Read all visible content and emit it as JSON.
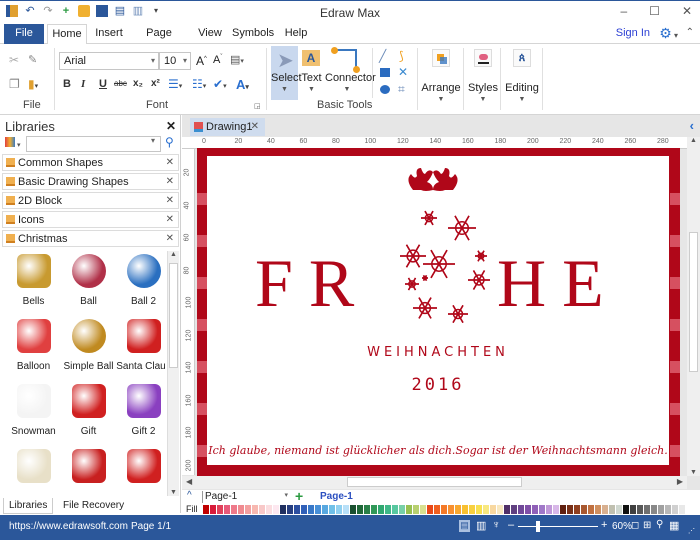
{
  "app": {
    "title": "Edraw Max",
    "window_controls": [
      "minimize",
      "maximize",
      "close"
    ]
  },
  "quick_access": [
    "app-logo-icon",
    "undo-icon",
    "redo-icon",
    "new-icon",
    "open-icon",
    "save-icon",
    "print-icon",
    "export-icon",
    "customize-icon"
  ],
  "menu": {
    "file": "File",
    "tabs": [
      "Home",
      "Insert",
      "Page Layout",
      "View",
      "Symbols",
      "Help"
    ],
    "active_tab": "Home",
    "sign_in": "Sign In"
  },
  "ribbon": {
    "groups": {
      "file": "File",
      "font": "Font",
      "basic_tools": "Basic Tools"
    },
    "font_name": "Arial",
    "font_size": "10",
    "format_buttons": [
      "B",
      "I",
      "U",
      "abc",
      "x₂",
      "x²"
    ],
    "tools": {
      "select": "Select",
      "text": "Text",
      "connector": "Connector"
    },
    "arrange": "Arrange",
    "styles": "Styles",
    "editing": "Editing"
  },
  "libraries": {
    "title": "Libraries",
    "search_placeholder": "",
    "items": [
      {
        "label": "Common Shapes"
      },
      {
        "label": "Basic Drawing Shapes"
      },
      {
        "label": "2D Block"
      },
      {
        "label": "Icons"
      },
      {
        "label": "Christmas"
      }
    ],
    "shapes": [
      {
        "name": "Bells",
        "color": "#c89a30"
      },
      {
        "name": "Ball",
        "color": "#b03048"
      },
      {
        "name": "Ball 2",
        "color": "#2a6fc0"
      },
      {
        "name": "Balloon",
        "color": "#e04040"
      },
      {
        "name": "Simple Ball",
        "color": "#c08a20"
      },
      {
        "name": "Santa Claus",
        "color": "#d02020"
      },
      {
        "name": "Snowman",
        "color": "#f4f4f4"
      },
      {
        "name": "Gift",
        "color": "#d02020"
      },
      {
        "name": "Gift 2",
        "color": "#8a40c0"
      },
      {
        "name": "",
        "color": "#e8e0c8"
      },
      {
        "name": "",
        "color": "#c82020"
      },
      {
        "name": "",
        "color": "#d02020"
      }
    ],
    "bottom_tabs": [
      "Libraries",
      "File Recovery"
    ]
  },
  "document": {
    "tab": "Drawing1",
    "ruler_h": [
      "0",
      "20",
      "40",
      "60",
      "80",
      "100",
      "120",
      "140",
      "160",
      "180",
      "200",
      "220",
      "240",
      "260",
      "280"
    ],
    "ruler_v": [
      "20",
      "40",
      "60",
      "80",
      "100",
      "120",
      "140",
      "160",
      "180",
      "200"
    ],
    "card": {
      "left_word": "FR",
      "right_word": "HE",
      "subtitle": "WEIHNACHTEN",
      "year": "2016",
      "quote": "Ich glaube, niemand ist glücklicher als dich.Sogar ist der Weihnachtsmann gleich.",
      "accent": "#b00719"
    }
  },
  "pages": {
    "selector": "Page-1",
    "current": "Page-1",
    "fill_label": "Fill"
  },
  "palette": [
    "#c00000",
    "#d81b3a",
    "#e0405a",
    "#e85a7a",
    "#ee7a8a",
    "#f08a90",
    "#f4a0a0",
    "#f7b8b0",
    "#f8c8c8",
    "#fbdde0",
    "#fde8f0",
    "#203060",
    "#283f80",
    "#2d4fa0",
    "#3060b8",
    "#3878c8",
    "#4890d8",
    "#58a8e0",
    "#70c0e8",
    "#90d0f0",
    "#b8e0f8",
    "#1a5030",
    "#206838",
    "#2a8048",
    "#309858",
    "#30a870",
    "#40b888",
    "#58c8a0",
    "#78d0a8",
    "#98c050",
    "#b8d070",
    "#d8e090",
    "#e84818",
    "#f06020",
    "#f47a28",
    "#f89030",
    "#f8a830",
    "#f8c030",
    "#f8d040",
    "#f8e050",
    "#f8e880",
    "#f8d8a0",
    "#f8e8c0",
    "#503068",
    "#604080",
    "#704898",
    "#8050a8",
    "#9060b8",
    "#a078c8",
    "#c098d8",
    "#d8b8e8",
    "#602010",
    "#783018",
    "#904020",
    "#a85830",
    "#c07040",
    "#d09060",
    "#d8b090",
    "#c0c0b0",
    "#d0d8d0",
    "#101010",
    "#404040",
    "#585858",
    "#707070",
    "#888888",
    "#a0a0a0",
    "#b8b8b8",
    "#d0d0d0",
    "#e8e8e8"
  ],
  "status": {
    "url": "https://www.edrawsoft.com",
    "page": "Page 1/1",
    "zoom": "60%",
    "zoom_level": 0.25
  }
}
